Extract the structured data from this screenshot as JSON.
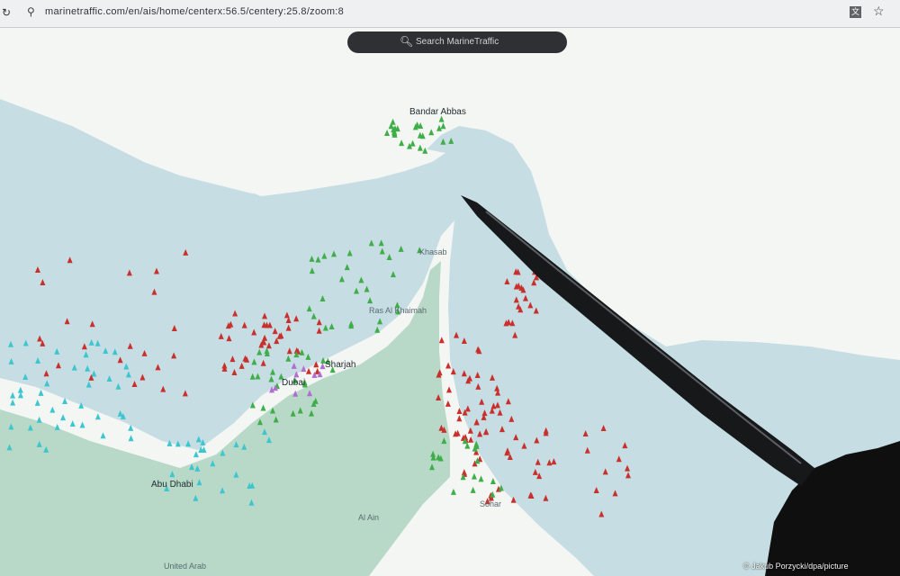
{
  "browser": {
    "url": "marinetraffic.com/en/ais/home/centerx:56.5/centery:25.8/zoom:8",
    "icons": {
      "reload": "reload-icon",
      "site_info": "site-info-icon",
      "translate": "translate-icon",
      "bookmark": "star-icon"
    }
  },
  "search": {
    "placeholder": "Search MarineTraffic",
    "icon": "search-icon"
  },
  "map": {
    "colors": {
      "sea": "#c6dde3",
      "land": "#f4f6f4",
      "uae_land": "#b8d9c8",
      "tanker": "#c9302c",
      "cargo": "#3fae49",
      "passenger": "#3ec6cf",
      "pleasure": "#b06fd0"
    },
    "labels": {
      "bandar_abbas": "Bandar Abbas",
      "khasab": "Khasab",
      "ras_al_khaimah": "Ras Al Khaimah",
      "sharjah": "Sharjah",
      "dubai": "Dubai",
      "abu_dhabi": "Abu Dhabi",
      "al_ain": "Al Ain",
      "uae": "United Arab",
      "sohar": "Sohar"
    }
  },
  "credit": "© Jakub Porzycki/dpa/picture"
}
